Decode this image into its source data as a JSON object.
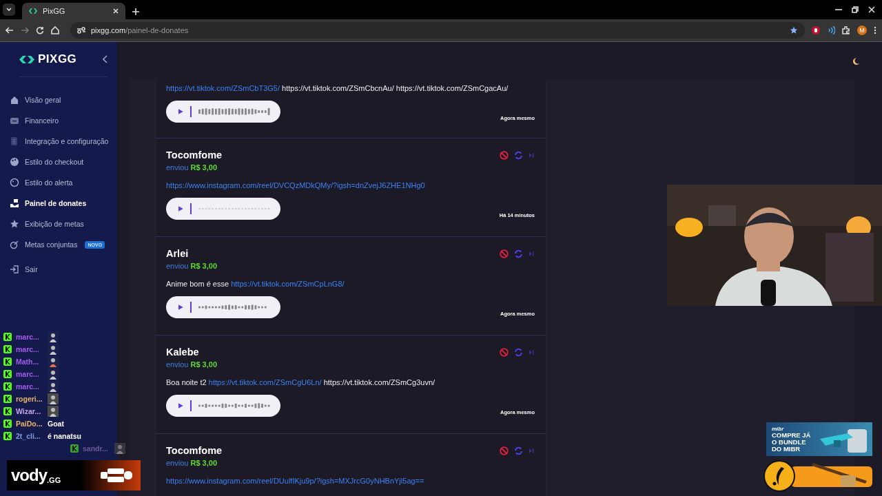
{
  "browser": {
    "tab": {
      "title": "PixGG"
    },
    "address": {
      "domain": "pixgg.com",
      "path": "/painel-de-donates"
    },
    "profile_initial": "M"
  },
  "sidebar": {
    "logo": "PIXGG",
    "items": [
      {
        "label": "Visão geral",
        "selected": false
      },
      {
        "label": "Financeiro",
        "selected": false
      },
      {
        "label": "Integração e configuração",
        "selected": false
      },
      {
        "label": "Estilo do checkout",
        "selected": false
      },
      {
        "label": "Estilo do alerta",
        "selected": false
      },
      {
        "label": "Painel de donates",
        "selected": true
      },
      {
        "label": "Exibição de metas",
        "selected": false
      },
      {
        "label": "Metas conjuntas",
        "badge": "NOVO",
        "selected": false
      },
      {
        "label": "Sair",
        "selected": false
      }
    ]
  },
  "donations": [
    {
      "message": [
        {
          "text": "https://vt.tiktok.com/ZSmCbT3G5/",
          "link": true
        },
        {
          "text": " https://vt.tiktok.com/ZSmCbcnAu/ https://vt.tiktok.com/ZSmCgacAu/",
          "link": false
        }
      ],
      "time": "Agora mesmo"
    },
    {
      "name": "Tocomfome",
      "sent": "enviou",
      "amount": "R$ 3,00",
      "message": [
        {
          "text": "https://www.instagram.com/reel/DVCQzMDkQMy/?igsh=dnZvejJ6ZHE1NHg0",
          "link": true
        }
      ],
      "time": "Há 14 minutos"
    },
    {
      "name": "Arlei",
      "sent": "enviou",
      "amount": "R$ 3,00",
      "message": [
        {
          "text": "Anime bom é esse ",
          "link": false
        },
        {
          "text": "https://vt.tiktok.com/ZSmCpLnG8/",
          "link": true
        }
      ],
      "time": "Agora mesmo"
    },
    {
      "name": "Kalebe",
      "sent": "enviou",
      "amount": "R$ 3,00",
      "message": [
        {
          "text": "Boa noite t2 ",
          "link": false
        },
        {
          "text": "https://vt.tiktok.com/ZSmCgU6Ln/",
          "link": true
        },
        {
          "text": " https://vt.tiktok.com/ZSmCg3uvn/",
          "link": false
        }
      ],
      "time": "Agora mesmo"
    },
    {
      "name": "Tocomfome",
      "sent": "enviou",
      "amount": "R$ 3,00",
      "message": [
        {
          "text": "https://www.instagram.com/reel/DUulfIKju9p/?igsh=MXJrcG0yNHBnYjl5ag==",
          "link": true
        }
      ]
    }
  ],
  "stream_overlay": {
    "chat": [
      {
        "user": "marc...",
        "color": "#a55bf0",
        "kind": "emote"
      },
      {
        "user": "marc...",
        "color": "#a55bf0",
        "kind": "emote"
      },
      {
        "user": "Math...",
        "color": "#a55bf0",
        "kind": "emote"
      },
      {
        "user": "marc...",
        "color": "#a55bf0",
        "kind": "emote"
      },
      {
        "user": "marc...",
        "color": "#a55bf0",
        "kind": "emote"
      },
      {
        "user": "rogeri...",
        "color": "#e8b46a",
        "kind": "emote"
      },
      {
        "user": "Wizar...",
        "color": "#c9a8f0",
        "kind": "emote"
      },
      {
        "user": "PaiDo...",
        "color": "#e8b46a",
        "kind": "text",
        "message": "Goat"
      },
      {
        "user": "2t_cli...",
        "color": "#7e9ee8",
        "kind": "text",
        "message": "é nanatsu"
      },
      {
        "user": "sandr...",
        "color": "#6a5a9a",
        "kind": "entering"
      }
    ],
    "brand": {
      "name": "vody",
      "suffix": ".GG"
    },
    "ad": {
      "logo": "mibr",
      "lines": [
        "COMPRE JÁ",
        "O BUNDLE",
        "DO MIBR"
      ]
    }
  }
}
